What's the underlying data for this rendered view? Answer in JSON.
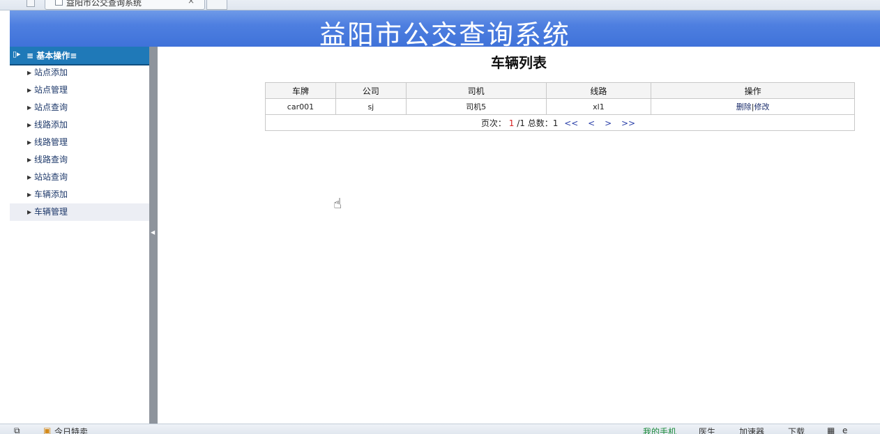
{
  "browser": {
    "tab_title": "益阳市公交查询系统",
    "tab_close": "×",
    "status_left": "今日特卖",
    "status_right": [
      "我的手机",
      "医生",
      "加速器",
      "下载"
    ]
  },
  "header": {
    "title": "益阳市公交查询系统"
  },
  "sidebar": {
    "section": "≡ 基本操作≡",
    "items": [
      {
        "label": "站点添加"
      },
      {
        "label": "站点管理"
      },
      {
        "label": "站点查询"
      },
      {
        "label": "线路添加"
      },
      {
        "label": "线路管理"
      },
      {
        "label": "线路查询"
      },
      {
        "label": "站站查询"
      },
      {
        "label": "车辆添加"
      },
      {
        "label": "车辆管理"
      }
    ],
    "active_index": 8
  },
  "main": {
    "title": "车辆列表",
    "columns": [
      "车牌",
      "公司",
      "司机",
      "线路",
      "操作"
    ],
    "rows": [
      {
        "plate": "car001",
        "company": "sj",
        "driver": "司机5",
        "route": "xl1",
        "delete": "删除",
        "sep": "|",
        "edit": "修改"
      }
    ],
    "pager": {
      "prefix": "页次：",
      "current": "1",
      "total_pages": "/1",
      "total_label": "总数：",
      "total": "1",
      "first": "<<",
      "prev": "<",
      "next": ">",
      "last": ">>"
    }
  },
  "colors": {
    "banner": "#4e7fe0",
    "sidebar_header": "#1f79b8",
    "splitter": "#8e949c",
    "pager_current": "#d42020"
  }
}
